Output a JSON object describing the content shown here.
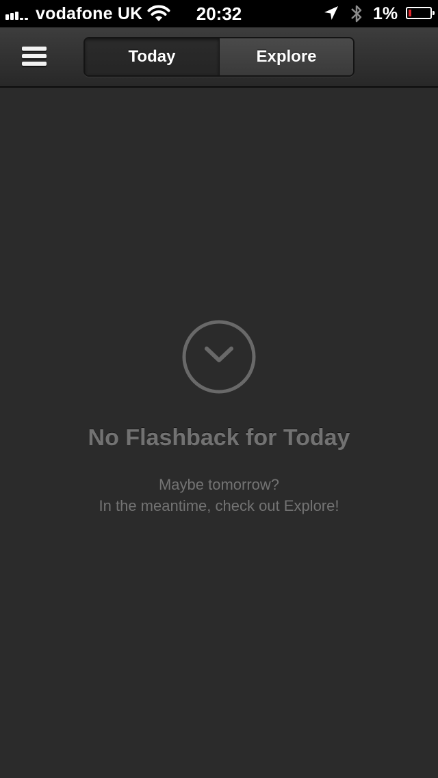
{
  "status_bar": {
    "carrier": "vodafone UK",
    "time": "20:32",
    "battery_percent": "1%",
    "battery_level": 0.01,
    "icons": [
      "signal-icon",
      "wifi-icon",
      "location-arrow-icon",
      "bluetooth-icon",
      "battery-icon"
    ]
  },
  "nav": {
    "menu_icon": "hamburger-menu-icon",
    "tabs": [
      {
        "label": "Today",
        "selected": true
      },
      {
        "label": "Explore",
        "selected": false
      }
    ]
  },
  "empty_state": {
    "icon": "check-circle-icon",
    "title": "No Flashback for Today",
    "line1": "Maybe tomorrow?",
    "line2": "In the meantime, check out Explore!"
  },
  "colors": {
    "background": "#2b2b2b",
    "status_bar": "#000000",
    "battery_low": "#e0262b",
    "empty_text": "#737373"
  }
}
